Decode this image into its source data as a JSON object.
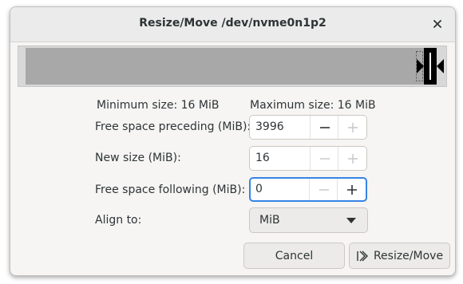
{
  "window": {
    "title": "Resize/Move /dev/nvme0n1p2"
  },
  "limits": {
    "minimum": "Minimum size: 16 MiB",
    "maximum": "Maximum size: 16 MiB"
  },
  "fields": {
    "preceding": {
      "label": "Free space preceding (MiB):",
      "value": "3996"
    },
    "new_size": {
      "label": "New size (MiB):",
      "value": "16"
    },
    "following": {
      "label": "Free space following (MiB):",
      "value": "0"
    },
    "align": {
      "label": "Align to:",
      "value": "MiB"
    }
  },
  "buttons": {
    "cancel": "Cancel",
    "resize": "Resize/Move"
  },
  "icons": {
    "close": "close-icon",
    "minus": "minus-icon",
    "plus": "plus-icon",
    "dropdown": "chevron-down-icon",
    "resize": "resize-move-icon"
  },
  "colors": {
    "focus": "#3584e4",
    "free_space": "#a8a8a8",
    "partition_handle": "#000000"
  }
}
